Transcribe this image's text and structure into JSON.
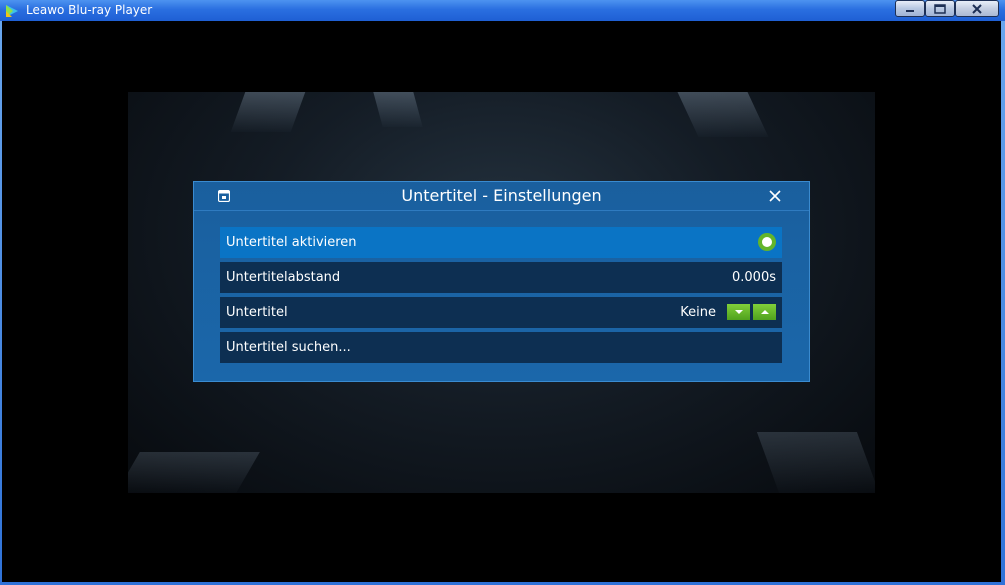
{
  "window": {
    "title": "Leawo Blu-ray Player",
    "controls": [
      "minimize-icon",
      "maximize-icon",
      "close-icon"
    ]
  },
  "dialog": {
    "title": "Untertitel - Einstellungen",
    "icon": "settings-panel-icon",
    "close_icon": "close-icon",
    "rows": [
      {
        "label": "Untertitel aktivieren",
        "control": "toggle",
        "value": "on"
      },
      {
        "label": "Untertitelabstand",
        "value": "0.000s"
      },
      {
        "label": "Untertitel",
        "value": "Keine",
        "control": "stepper"
      },
      {
        "label": "Untertitel suchen..."
      }
    ]
  },
  "colors": {
    "titlebar": "#2a6fe0",
    "dialog_bg": "#1b67aa",
    "row_active": "#0a74c5",
    "row_bg": "#0d2f52",
    "accent_green": "#63b52a"
  }
}
